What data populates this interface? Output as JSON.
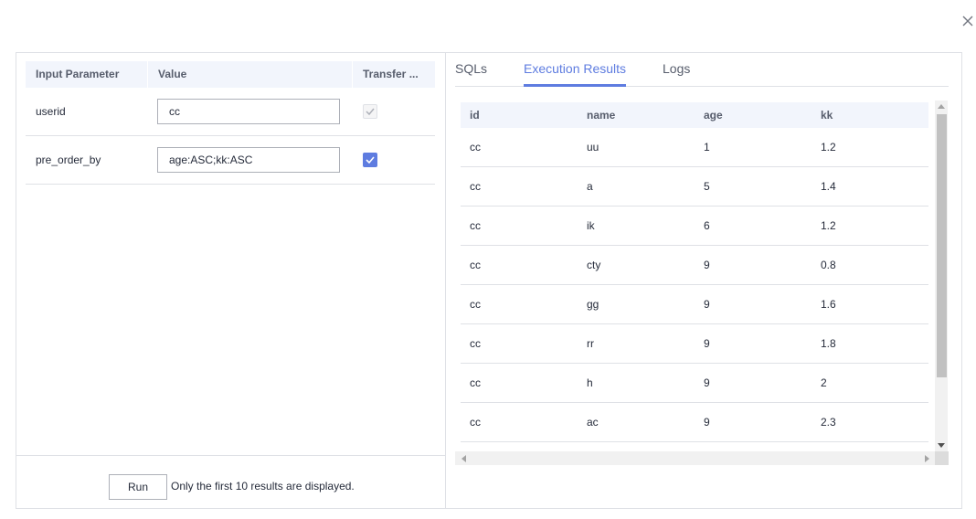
{
  "params": {
    "headers": [
      "Input Parameter",
      "Value",
      "Transfer ..."
    ],
    "rows": [
      {
        "name": "userid",
        "value": "cc",
        "transfer": "disabled-checked"
      },
      {
        "name": "pre_order_by",
        "value": "age:ASC;kk:ASC",
        "transfer": "checked"
      }
    ]
  },
  "footer": {
    "run_label": "Run",
    "note": "Only the first 10 results are displayed."
  },
  "tabs": [
    "SQLs",
    "Execution Results",
    "Logs"
  ],
  "active_tab": "Execution Results",
  "results": {
    "headers": [
      "id",
      "name",
      "age",
      "kk"
    ],
    "rows": [
      [
        "cc",
        "uu",
        "1",
        "1.2"
      ],
      [
        "cc",
        "a",
        "5",
        "1.4"
      ],
      [
        "cc",
        "ik",
        "6",
        "1.2"
      ],
      [
        "cc",
        "cty",
        "9",
        "0.8"
      ],
      [
        "cc",
        "gg",
        "9",
        "1.6"
      ],
      [
        "cc",
        "rr",
        "9",
        "1.8"
      ],
      [
        "cc",
        "h",
        "9",
        "2"
      ],
      [
        "cc",
        "ac",
        "9",
        "2.3"
      ]
    ]
  },
  "colors": {
    "accent": "#5e7ce0",
    "header_bg": "#f2f5fc",
    "border": "#dfe1e6"
  },
  "icons": {
    "close": "close-icon",
    "check": "check-icon"
  }
}
